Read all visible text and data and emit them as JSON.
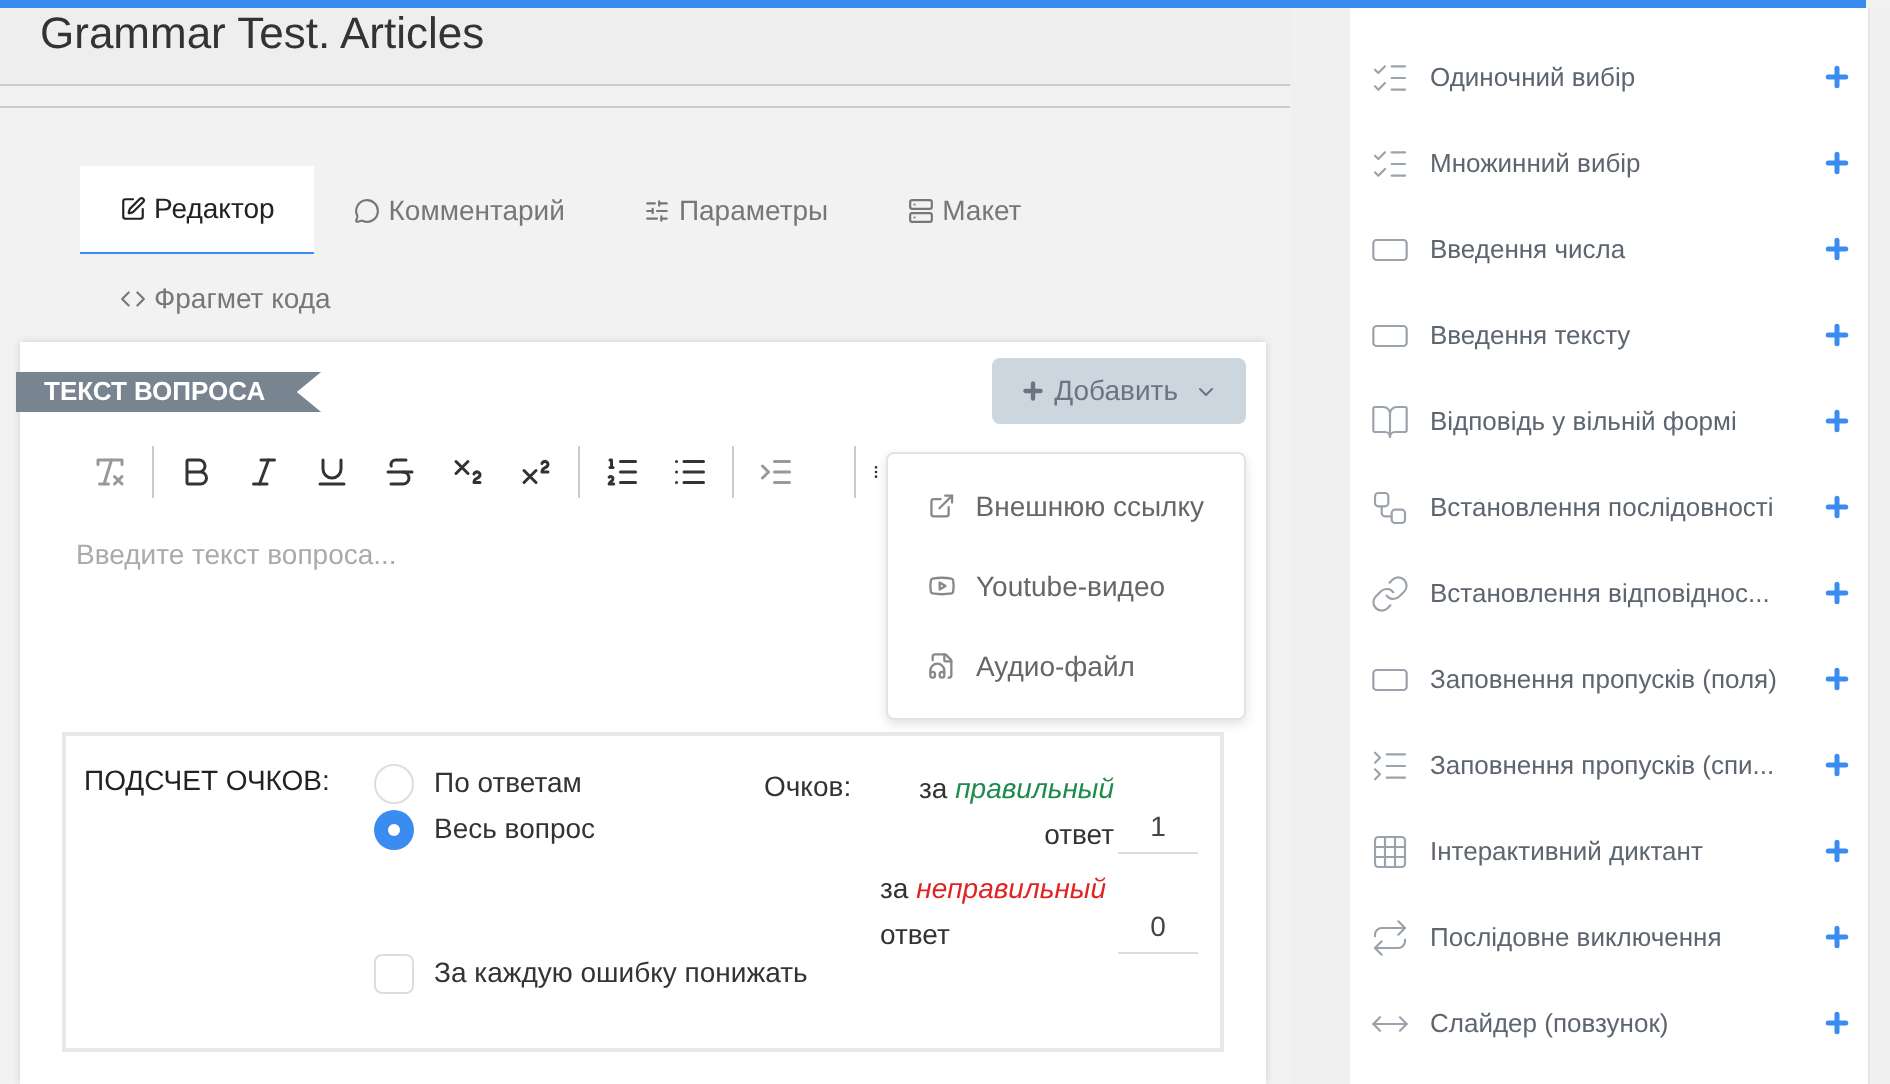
{
  "header": {
    "title": "Grammar Test. Articles"
  },
  "tabs": [
    {
      "label": "Редактор",
      "selected": true
    },
    {
      "label": "Комментарий",
      "selected": false
    },
    {
      "label": "Параметры",
      "selected": false
    },
    {
      "label": "Макет",
      "selected": false
    },
    {
      "label": "Фрагмет кода",
      "selected": false
    }
  ],
  "editor": {
    "ribbon": "ТЕКСТ ВОПРОСА",
    "add_button": {
      "label": "Добавить",
      "expanded": true
    },
    "menu": [
      "Внешнюю ссылку",
      "Youtube-видео",
      "Аудио-файл"
    ],
    "placeholder": "Введите текст вопроса..."
  },
  "scoring": {
    "title": "ПОДСЧЕТ ОЧКОВ:",
    "options": [
      {
        "label": "По ответам",
        "selected": false
      },
      {
        "label": "Весь вопрос",
        "selected": true
      }
    ],
    "points_label": "Очков:",
    "points": [
      {
        "prefix": "за",
        "emph": "правильный",
        "suffix": "ответ",
        "color": "#1e8a4c",
        "value": "1"
      },
      {
        "prefix": "за",
        "emph": "неправильный",
        "suffix": "ответ",
        "color": "#e02424",
        "value": "0"
      }
    ],
    "penalty": {
      "label": "За каждую ошибку понижать",
      "checked": false
    }
  },
  "sidebar": {
    "items": [
      "Одиночний вибір",
      "Множинний вибір",
      "Введення числа",
      "Введення тексту",
      "Відповідь у вільній формі",
      "Встановлення послідовності",
      "Встановлення відповіднос...",
      "Заповнення пропусків (поля)",
      "Заповнення пропусків (спи...",
      "Інтерактивний диктант",
      "Послідовне виключення",
      "Слайдер (повзунок)"
    ]
  }
}
